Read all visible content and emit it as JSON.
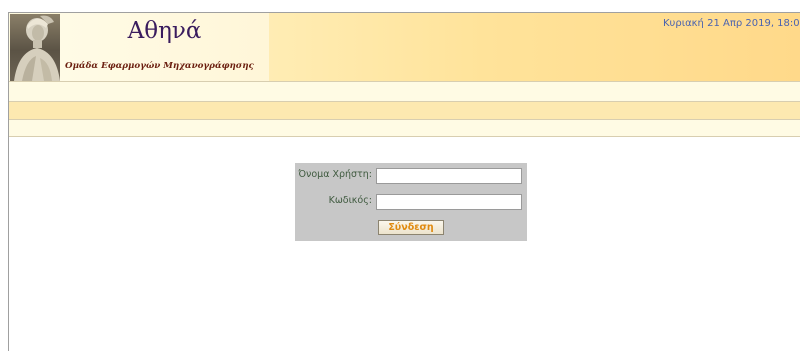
{
  "header": {
    "title": "Αθηνά",
    "subtitle": "Ομάδα Εφαρμογών Μηχανογράφησης",
    "datetime": "Κυριακή 21 Απρ 2019, 18:0",
    "logo_icon": "athena-statue-icon"
  },
  "login": {
    "username_label": "Όνομα Χρήστη:",
    "username_value": "",
    "password_label": "Κωδικός:",
    "password_value": "",
    "submit_label": "Σύνδεση"
  },
  "colors": {
    "header_gradient_start": "#fffbe0",
    "header_gradient_end": "#ffd98a",
    "title_color": "#3a1c5e",
    "subtitle_color": "#6b1f10",
    "datetime_color": "#4a63b0",
    "login_panel": "#c7c7c7",
    "button_text": "#e08a10"
  }
}
